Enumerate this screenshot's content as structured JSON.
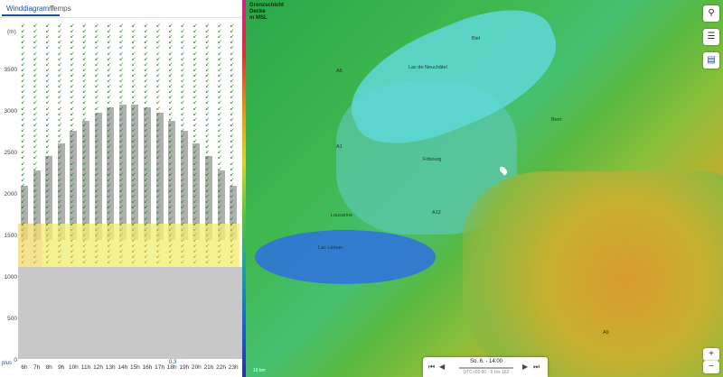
{
  "tabs": {
    "wind": "Winddiagramm",
    "temps": "Temps"
  },
  "yaxis": {
    "unit": "(m)",
    "labels": [
      "3500",
      "3000",
      "2500",
      "2000",
      "1500",
      "1000",
      "500",
      "0"
    ]
  },
  "xaxis": {
    "labels": [
      "6h",
      "7h",
      "8h",
      "9h",
      "10h",
      "11h",
      "12h",
      "13h",
      "14h",
      "15h",
      "16h",
      "17h",
      "18h",
      "19h",
      "20h",
      "21h",
      "22h",
      "23h"
    ]
  },
  "plus_link": "plus",
  "value_03": "0.3",
  "map": {
    "title_line1": "Grenzschicht",
    "title_line2": "Decke",
    "title_line3": "m MSL",
    "labels": [
      {
        "text": "A1"
      },
      {
        "text": "A5"
      },
      {
        "text": "A9"
      },
      {
        "text": "A12"
      },
      {
        "text": "Lac de Neuchâtel"
      },
      {
        "text": "Lac Léman"
      },
      {
        "text": "Lausanne"
      },
      {
        "text": "Fribourg"
      },
      {
        "text": "Bern"
      },
      {
        "text": "Biel"
      }
    ],
    "scale": "10 km",
    "time_main": "So. 6. - 14:00",
    "time_sub": "UTC+02:00 · 0 hrs 162"
  }
}
